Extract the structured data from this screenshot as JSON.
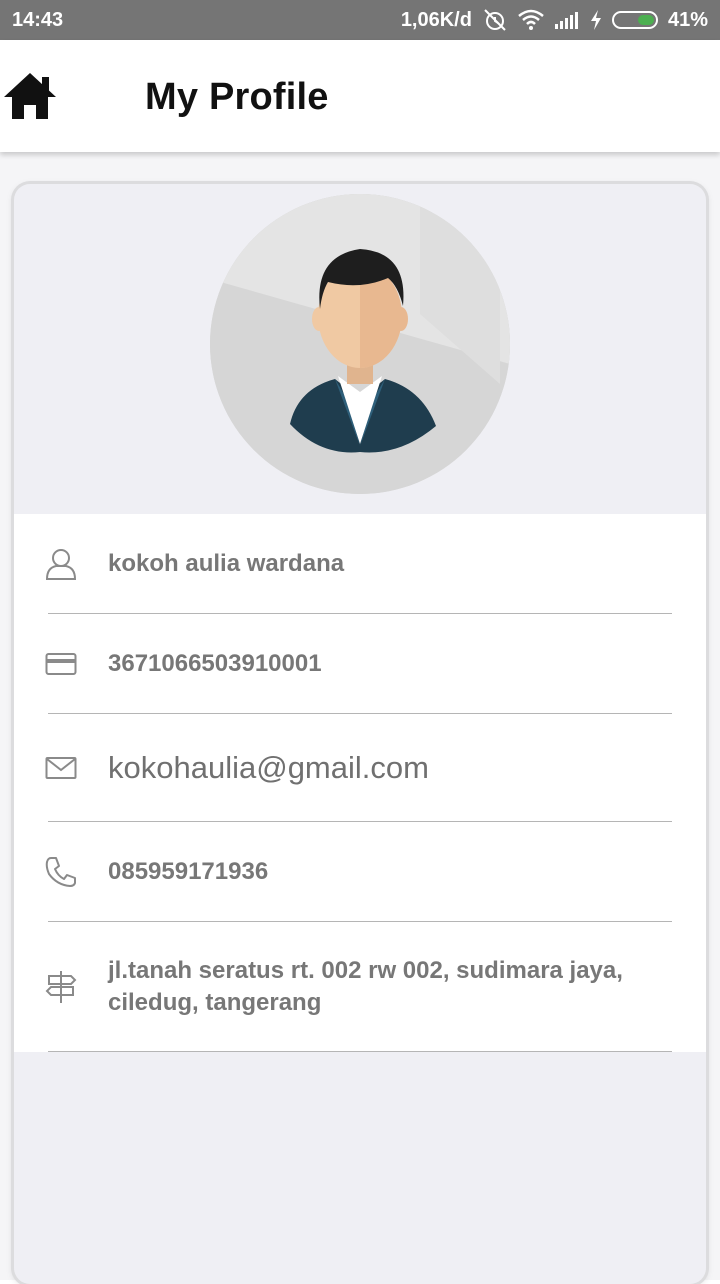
{
  "status_bar": {
    "time": "14:43",
    "net_speed": "1,06K/d",
    "battery_percent": "41%",
    "battery_level": 0.41
  },
  "app_bar": {
    "title": "My Profile"
  },
  "profile": {
    "name": "kokoh aulia wardana",
    "id_number": "3671066503910001",
    "email": "kokohaulia@gmail.com",
    "phone": "085959171936",
    "address": "jl.tanah seratus rt. 002 rw 002, sudimara jaya, ciledug, tangerang"
  },
  "icons": {
    "home": "home-icon",
    "name": "user-icon",
    "id": "card-icon",
    "email": "mail-icon",
    "phone": "phone-icon",
    "address": "signpost-icon"
  },
  "colors": {
    "status_bar": "#757575",
    "battery": "#4caf50",
    "suit": "#1f3d4e"
  }
}
